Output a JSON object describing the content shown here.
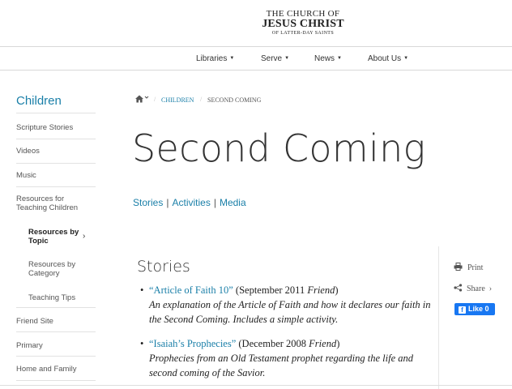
{
  "logo": {
    "line1": "THE CHURCH OF",
    "line2": "JESUS CHRIST",
    "line3": "OF LATTER-DAY SAINTS"
  },
  "topnav": [
    {
      "label": "Libraries"
    },
    {
      "label": "Serve"
    },
    {
      "label": "News"
    },
    {
      "label": "About Us"
    }
  ],
  "sidebar": {
    "title": "Children",
    "items": [
      {
        "label": "Scripture Stories"
      },
      {
        "label": "Videos"
      },
      {
        "label": "Music"
      },
      {
        "label": "Resources for Teaching Children"
      },
      {
        "label": "Resources by Topic",
        "active": true
      },
      {
        "label": "Resources by Category"
      },
      {
        "label": "Teaching Tips"
      },
      {
        "label": "Friend Site"
      },
      {
        "label": "Primary"
      },
      {
        "label": "Home and Family"
      }
    ]
  },
  "breadcrumb": {
    "items": [
      "CHILDREN",
      "SECOND COMING"
    ]
  },
  "page_title": "Second Coming",
  "section_links": [
    "Stories",
    "Activities",
    "Media"
  ],
  "stories": {
    "heading": "Stories",
    "items": [
      {
        "title": "“Article of Faith 10”",
        "date": "(September 2011",
        "publication": "Friend",
        "close": ")",
        "description": "An explanation of the Article of Faith and how it declares our faith in the Second Coming. Includes a simple activity."
      },
      {
        "title": "“Isaiah’s Prophecies”",
        "date": "(December 2008",
        "publication": "Friend",
        "close": ")",
        "description": "Prophecies from an Old Testament prophet regarding the life and second coming of the Savior."
      }
    ]
  },
  "tools": {
    "print": "Print",
    "share": "Share",
    "like": "Like 0"
  }
}
